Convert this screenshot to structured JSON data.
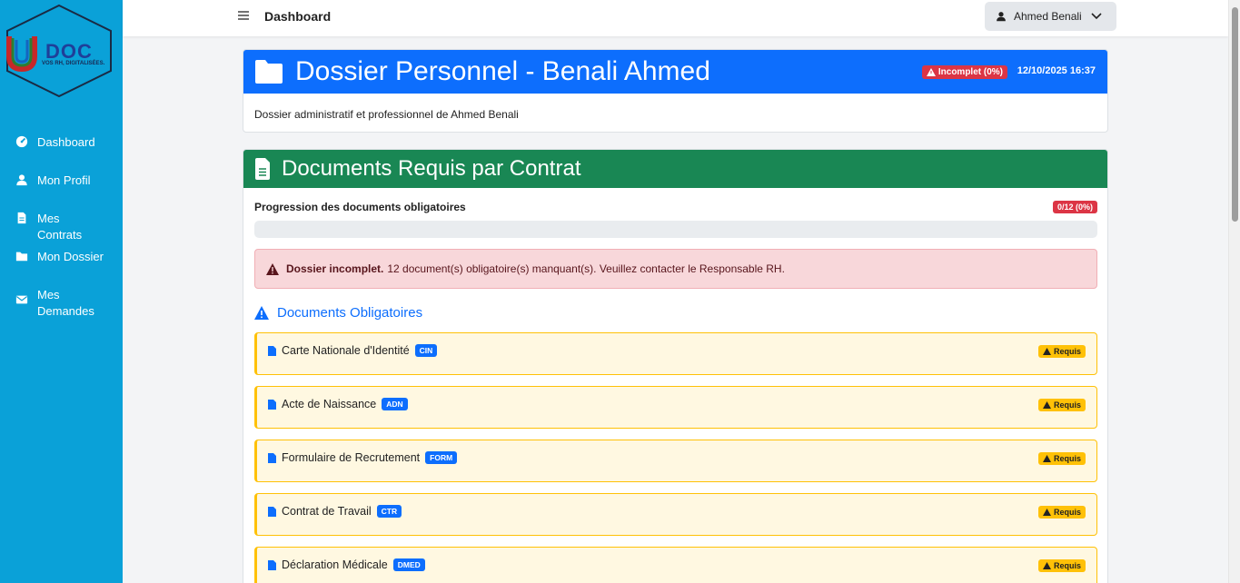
{
  "brand": {
    "logo_text": "DOC",
    "tagline": "VOS RH, DIGITALISÉES.",
    "logo_letter": "U"
  },
  "sidebar": {
    "items": [
      {
        "label": "Dashboard",
        "icon": "dashboard-icon"
      },
      {
        "label": "Mon Profil",
        "icon": "user-icon"
      },
      {
        "label": "Mes Contrats",
        "icon": "file-icon"
      },
      {
        "label": "Mon Dossier",
        "icon": "folder-icon"
      },
      {
        "label": "Mes Demandes",
        "icon": "envelope-icon"
      }
    ]
  },
  "topbar": {
    "title": "Dashboard",
    "user_name": "Ahmed Benali"
  },
  "dossier": {
    "title": "Dossier Personnel - Benali Ahmed",
    "status_badge": "Incomplet (0%)",
    "date": "12/10/2025 16:37",
    "description": "Dossier administratif et professionnel de Ahmed Benali"
  },
  "documents": {
    "title": "Documents Requis par Contrat",
    "progress_label": "Progression des documents obligatoires",
    "progress_badge": "0/12 (0%)",
    "progress_value": 0,
    "alert_strong": "Dossier incomplet.",
    "alert_text": "12 document(s) obligatoire(s) manquant(s). Veuillez contacter le Responsable RH.",
    "section_title": "Documents Obligatoires",
    "required_label": "Requis",
    "items": [
      {
        "name": "Carte Nationale d'Identité",
        "code": "CIN"
      },
      {
        "name": "Acte de Naissance",
        "code": "ADN"
      },
      {
        "name": "Formulaire de Recrutement",
        "code": "FORM"
      },
      {
        "name": "Contrat de Travail",
        "code": "CTR"
      },
      {
        "name": "Déclaration Médicale",
        "code": "DMED"
      }
    ]
  },
  "colors": {
    "sidebar": "#0aa1d8",
    "primary": "#0d6efd",
    "success": "#198754",
    "danger": "#dc3545",
    "warning": "#ffc107"
  }
}
